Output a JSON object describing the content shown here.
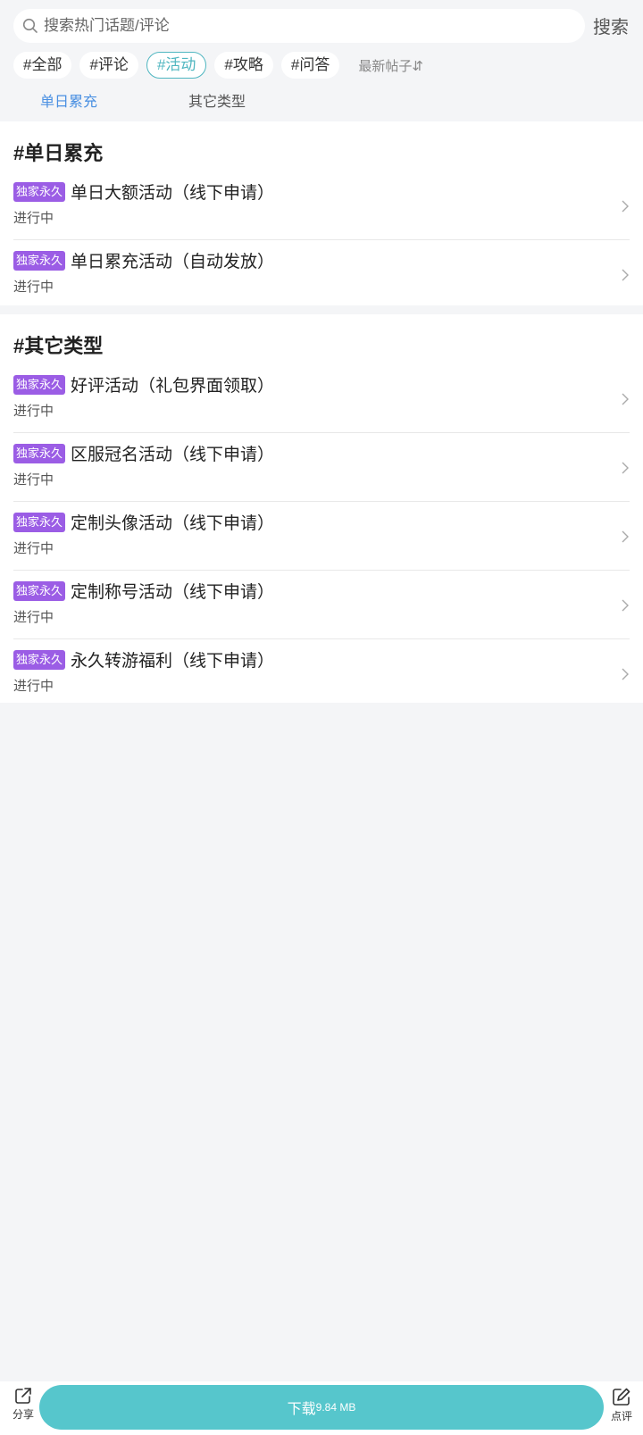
{
  "search": {
    "placeholder": "搜索热门话题/评论",
    "button_label": "搜索"
  },
  "tags": [
    {
      "label": "#全部"
    },
    {
      "label": "#评论"
    },
    {
      "label": "#活动",
      "active": true
    },
    {
      "label": "#攻略"
    },
    {
      "label": "#问答"
    }
  ],
  "sort_label": "最新帖子⇵",
  "anchor_tabs": [
    {
      "label": "单日累充",
      "active": true
    },
    {
      "label": "其它类型"
    }
  ],
  "sections": [
    {
      "title": "#单日累充",
      "items": [
        {
          "badge": "独家永久",
          "title": "单日大额活动（线下申请）",
          "status": "进行中"
        },
        {
          "badge": "独家永久",
          "title": "单日累充活动（自动发放）",
          "status": "进行中"
        }
      ]
    },
    {
      "title": "#其它类型",
      "items": [
        {
          "badge": "独家永久",
          "title": "好评活动（礼包界面领取）",
          "status": "进行中"
        },
        {
          "badge": "独家永久",
          "title": "区服冠名活动（线下申请）",
          "status": "进行中"
        },
        {
          "badge": "独家永久",
          "title": "定制头像活动（线下申请）",
          "status": "进行中"
        },
        {
          "badge": "独家永久",
          "title": "定制称号活动（线下申请）",
          "status": "进行中"
        },
        {
          "badge": "独家永久",
          "title": "永久转游福利（线下申请）",
          "status": "进行中"
        }
      ]
    }
  ],
  "bottom": {
    "share_label": "分享",
    "download_label": "下载",
    "download_size": "9.84 MB",
    "review_label": "点评"
  },
  "colors": {
    "accent_teal": "#56c6cc",
    "tag_active": "#4fb6c0",
    "tab_active": "#4a90e2",
    "badge": "#9b5de5"
  },
  "icons": {
    "search": "search-icon",
    "chevron": "chevron-right-icon",
    "share": "share-icon",
    "review": "edit-icon"
  }
}
